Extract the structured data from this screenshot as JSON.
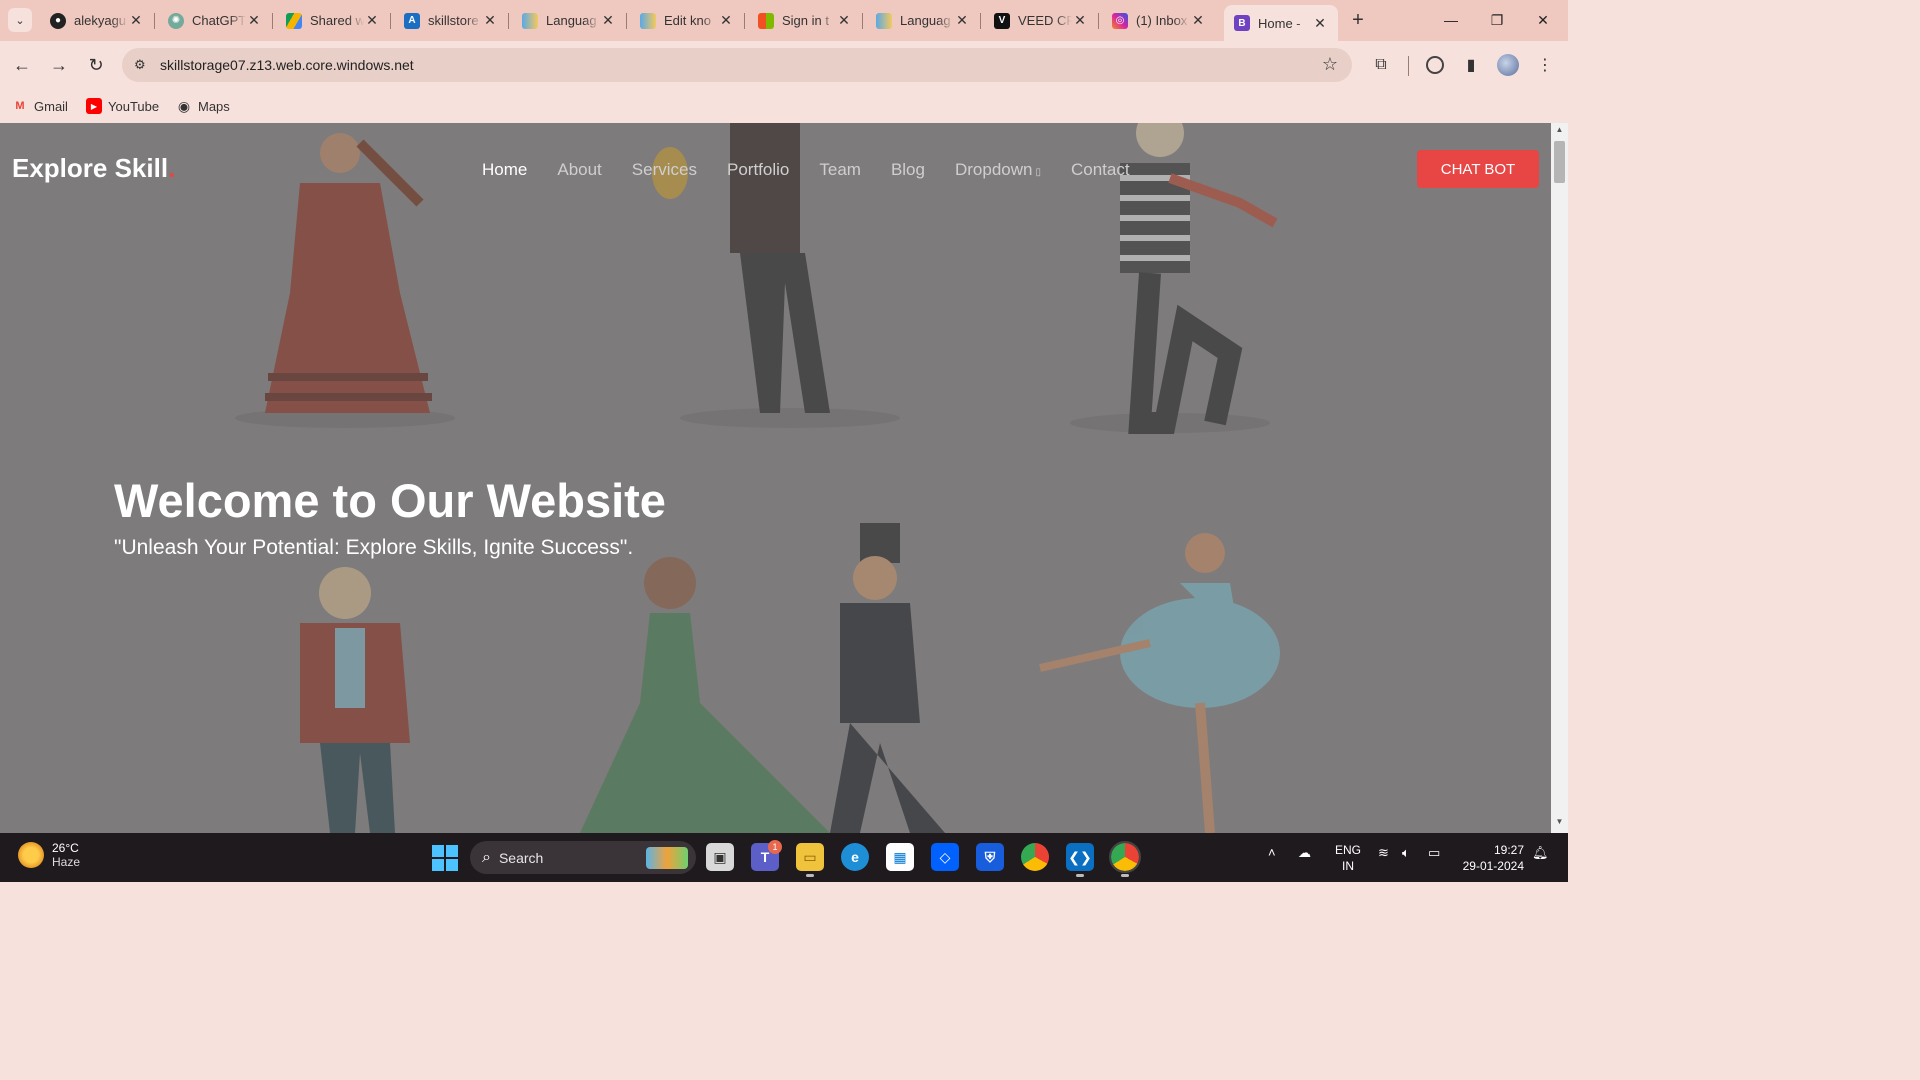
{
  "browser": {
    "tabs": [
      {
        "title": "alekyagu",
        "icon": "github-icon",
        "color": "#222222"
      },
      {
        "title": "ChatGPT",
        "icon": "chatgpt-icon",
        "color": "#74aa9c"
      },
      {
        "title": "Shared w",
        "icon": "google-drive-icon",
        "color": "#f4b400"
      },
      {
        "title": "skillstore",
        "icon": "azure-icon",
        "color": "#1b6ec2"
      },
      {
        "title": "Languag",
        "icon": "azure-cloud-icon",
        "color": "#5aa9e6"
      },
      {
        "title": "Edit kno",
        "icon": "azure-cloud-icon",
        "color": "#5aa9e6"
      },
      {
        "title": "Sign in t",
        "icon": "microsoft-icon",
        "color": "#f25022"
      },
      {
        "title": "Languag",
        "icon": "azure-cloud-icon",
        "color": "#5aa9e6"
      },
      {
        "title": "VEED CR",
        "icon": "veed-icon",
        "color": "#111111"
      },
      {
        "title": "(1) Inbox",
        "icon": "instagram-icon",
        "color": "#d6249f"
      },
      {
        "title": "Home - ",
        "icon": "bootstrap-icon",
        "color": "#6f42c1",
        "active": true
      }
    ],
    "new_tab": "+",
    "url": "skillstorage07.z13.web.core.windows.net",
    "bookmarks": [
      {
        "label": "Gmail",
        "icon": "gmail-icon"
      },
      {
        "label": "YouTube",
        "icon": "youtube-icon"
      },
      {
        "label": "Maps",
        "icon": "globe-icon"
      }
    ]
  },
  "site": {
    "logo": "Explore Skill",
    "logo_dot": ".",
    "nav": [
      {
        "label": "Home",
        "active": true
      },
      {
        "label": "About"
      },
      {
        "label": "Services"
      },
      {
        "label": "Portfolio"
      },
      {
        "label": "Team"
      },
      {
        "label": "Blog"
      },
      {
        "label": "Dropdown",
        "caret": "▯"
      },
      {
        "label": "Contact"
      }
    ],
    "cta": "CHAT BOT",
    "hero_title": "Welcome to Our Website",
    "hero_subtitle": "\"Unleash Your Potential: Explore Skills, Ignite Success\".",
    "accent_color": "#e84545"
  },
  "taskbar": {
    "weather_temp": "26°C",
    "weather_desc": "Haze",
    "search_label": "Search",
    "apps": [
      "file-explorer-window-icon",
      "teams-icon",
      "file-explorer-icon",
      "edge-icon",
      "store-icon",
      "dropbox-icon",
      "bitwarden-icon",
      "chrome-icon",
      "vscode-icon",
      "chrome-profile-icon"
    ],
    "teams_badge": "1",
    "lang_line1": "ENG",
    "lang_line2": "IN",
    "time": "19:27",
    "date": "29-01-2024"
  }
}
